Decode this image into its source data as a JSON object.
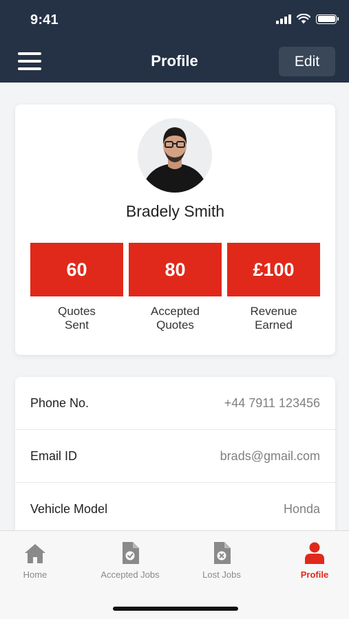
{
  "status_bar": {
    "time": "9:41"
  },
  "header": {
    "title": "Profile",
    "edit_label": "Edit"
  },
  "profile": {
    "name": "Bradely Smith",
    "stats": [
      {
        "value": "60",
        "label": "Quotes Sent"
      },
      {
        "value": "80",
        "label": "Accepted Quotes"
      },
      {
        "value": "£100",
        "label": "Revenue Earned"
      }
    ]
  },
  "details": [
    {
      "label": "Phone No.",
      "value": "+44 7911 123456"
    },
    {
      "label": "Email ID",
      "value": "brads@gmail.com"
    },
    {
      "label": "Vehicle Model",
      "value": "Honda"
    }
  ],
  "tabs": [
    {
      "label": "Home",
      "icon": "home-icon"
    },
    {
      "label": "Accepted Jobs",
      "icon": "document-check-icon"
    },
    {
      "label": "Lost Jobs",
      "icon": "document-x-icon"
    },
    {
      "label": "Profile",
      "icon": "user-icon"
    }
  ],
  "colors": {
    "header": "#253246",
    "accent": "#e0291a",
    "tab_inactive": "#8a8a8a"
  }
}
